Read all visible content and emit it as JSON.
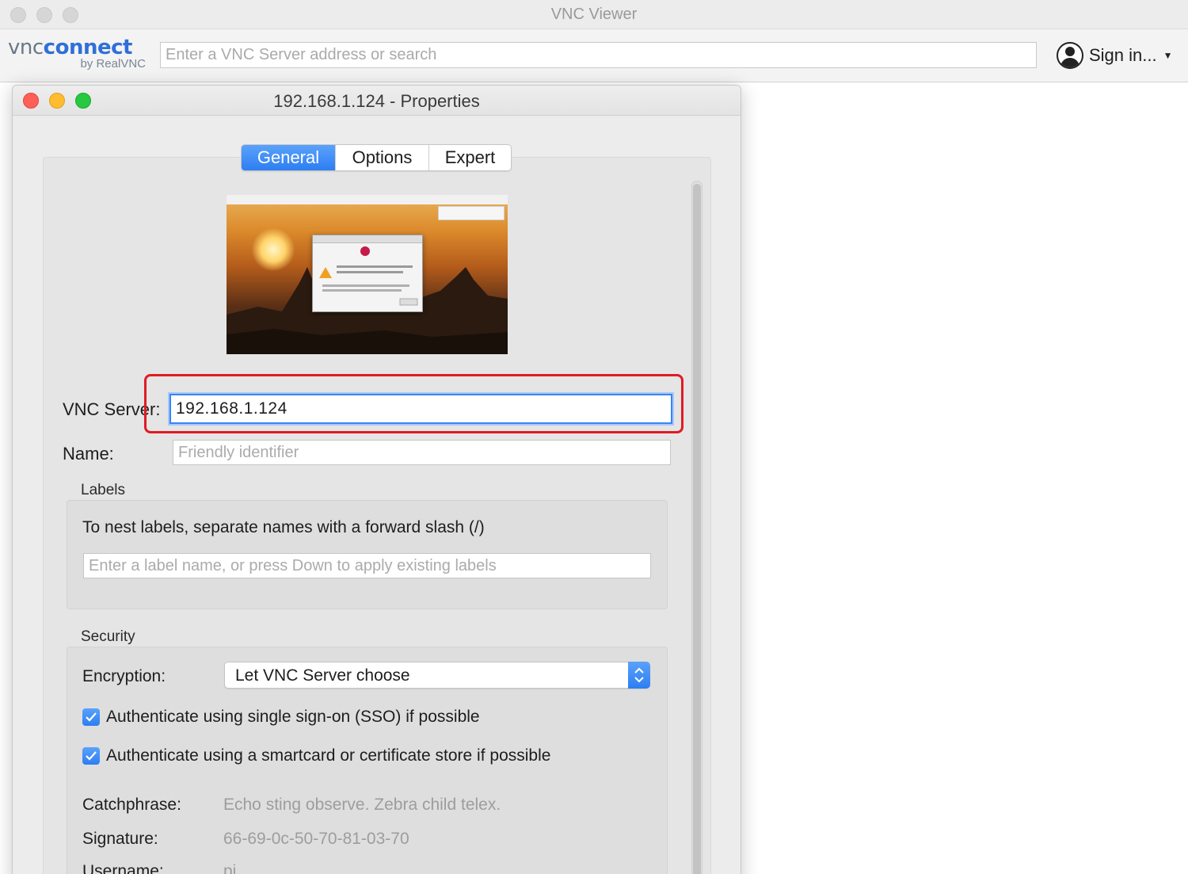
{
  "app": {
    "title": "VNC Viewer",
    "logo_primary": "vnc",
    "logo_secondary": "connect",
    "logo_sub": "by RealVNC",
    "search_placeholder": "Enter a VNC Server address or search",
    "signin_label": "Sign in...",
    "signin_caret": "▼"
  },
  "dialog": {
    "title": "192.168.1.124 - Properties",
    "tabs": [
      {
        "label": "General",
        "active": true
      },
      {
        "label": "Options",
        "active": false
      },
      {
        "label": "Expert",
        "active": false
      }
    ],
    "vnc_server_label": "VNC Server:",
    "vnc_server_value": "192.168.1.124",
    "name_label": "Name:",
    "name_placeholder": "Friendly identifier",
    "labels_group": {
      "title": "Labels",
      "hint": "To nest labels, separate names with a forward slash (/)",
      "input_placeholder": "Enter a label name, or press Down to apply existing labels"
    },
    "security_group": {
      "title": "Security",
      "encryption_label": "Encryption:",
      "encryption_value": "Let VNC Server choose",
      "sso_label": "Authenticate using single sign-on (SSO) if possible",
      "sso_checked": true,
      "smartcard_label": "Authenticate using a smartcard or certificate store if possible",
      "smartcard_checked": true,
      "catchphrase_label": "Catchphrase:",
      "catchphrase_value": "Echo sting observe. Zebra child telex.",
      "signature_label": "Signature:",
      "signature_value": "66-69-0c-50-70-81-03-70",
      "username_label": "Username:",
      "username_value": "pi"
    }
  },
  "colors": {
    "accent": "#2d7ef2",
    "highlight": "#e01b24",
    "close": "#fe5f57",
    "minimize": "#febc2e",
    "maximize": "#28c840"
  }
}
